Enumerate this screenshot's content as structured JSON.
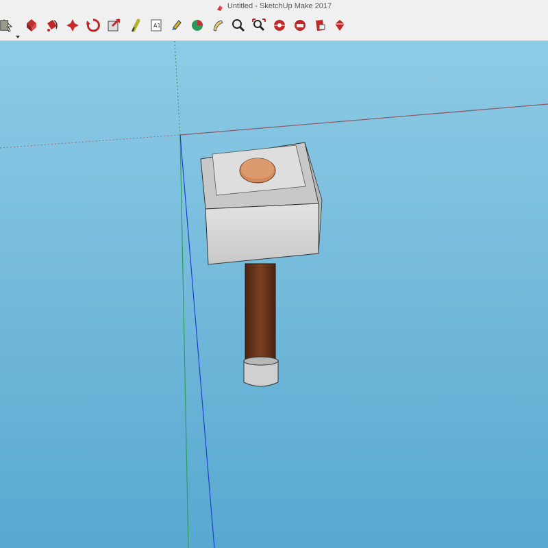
{
  "window": {
    "title": "Untitled - SketchUp Make 2017",
    "app_icon": "sketchup-icon"
  },
  "toolbar": {
    "tools": [
      {
        "name": "select-tool",
        "icon": "arrow-icon"
      },
      {
        "name": "make-component-tool",
        "icon": "component-icon"
      },
      {
        "name": "paint-bucket-tool",
        "icon": "paint-bucket-icon"
      },
      {
        "name": "eraser-tool",
        "icon": "eraser-icon"
      },
      {
        "name": "rectangle-tool",
        "icon": "rectangle-icon",
        "has_dropdown": true
      },
      {
        "name": "push-pull-tool",
        "icon": "push-pull-icon"
      },
      {
        "name": "follow-me-tool",
        "icon": "follow-me-icon"
      },
      {
        "name": "move-tool",
        "icon": "move-icon"
      },
      {
        "name": "rotate-tool",
        "icon": "rotate-icon"
      },
      {
        "name": "scale-tool",
        "icon": "scale-icon"
      },
      {
        "name": "tape-measure-tool",
        "icon": "tape-measure-icon"
      },
      {
        "name": "text-tool",
        "icon": "text-icon",
        "label": "A1"
      },
      {
        "name": "paint-tool",
        "icon": "paint-icon"
      },
      {
        "name": "orbit-tool",
        "icon": "orbit-icon"
      },
      {
        "name": "pan-tool",
        "icon": "hand-icon"
      },
      {
        "name": "zoom-tool",
        "icon": "magnifier-icon"
      },
      {
        "name": "zoom-extents-tool",
        "icon": "zoom-extents-icon"
      },
      {
        "name": "3d-warehouse-tool",
        "icon": "warehouse-icon"
      },
      {
        "name": "share-model-tool",
        "icon": "share-icon"
      },
      {
        "name": "extension-warehouse-tool",
        "icon": "extension-icon"
      },
      {
        "name": "sketchup-ruby-tool",
        "icon": "ruby-icon"
      }
    ]
  },
  "viewport": {
    "background_color": "#6fb0d6",
    "model": "hammer",
    "axis_colors": {
      "red": "#b04a4a",
      "green": "#2e9e5a",
      "blue": "#1f3fd0"
    },
    "materials": {
      "head": "#d4d4d4",
      "handle": "#6a3518",
      "cap": "#d08a5e",
      "ferrule": "#c8c8c8"
    }
  }
}
